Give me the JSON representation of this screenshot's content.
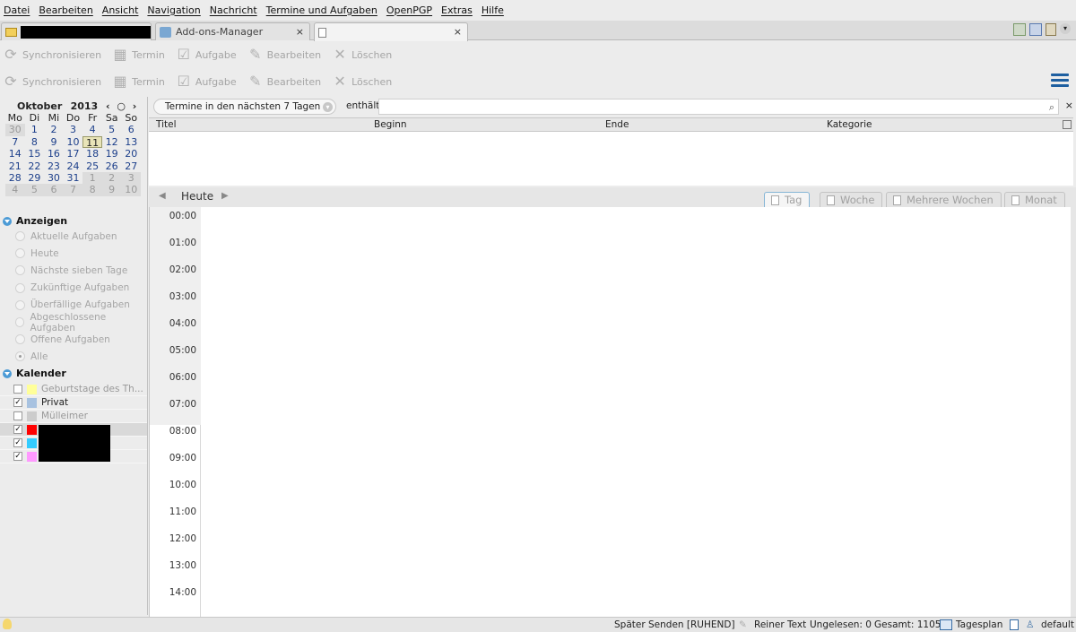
{
  "menu": [
    "Datei",
    "Bearbeiten",
    "Ansicht",
    "Navigation",
    "Nachricht",
    "Termine und Aufgaben",
    "OpenPGP",
    "Extras",
    "Hilfe"
  ],
  "tabs": {
    "addons": "Add-ons-Manager"
  },
  "toolbar": {
    "sync": "Synchronisieren",
    "event": "Termin",
    "task": "Aufgabe",
    "edit": "Bearbeiten",
    "delete": "Löschen"
  },
  "minimonth": {
    "month": "Oktober",
    "year": "2013",
    "dows": [
      "Mo",
      "Di",
      "Mi",
      "Do",
      "Fr",
      "Sa",
      "So"
    ],
    "weeks": [
      [
        "30",
        "1",
        "2",
        "3",
        "4",
        "5",
        "6"
      ],
      [
        "7",
        "8",
        "9",
        "10",
        "11",
        "12",
        "13"
      ],
      [
        "14",
        "15",
        "16",
        "17",
        "18",
        "19",
        "20"
      ],
      [
        "21",
        "22",
        "23",
        "24",
        "25",
        "26",
        "27"
      ],
      [
        "28",
        "29",
        "30",
        "31",
        "1",
        "2",
        "3"
      ],
      [
        "4",
        "5",
        "6",
        "7",
        "8",
        "9",
        "10"
      ]
    ],
    "today": "11"
  },
  "sidebar": {
    "show_label": "Anzeigen",
    "filters": [
      "Aktuelle Aufgaben",
      "Heute",
      "Nächste sieben Tage",
      "Zukünftige Aufgaben",
      "Überfällige Aufgaben",
      "Abgeschlossene Aufgaben",
      "Offene Aufgaben",
      "Alle"
    ],
    "calendars_label": "Kalender",
    "calendars": [
      {
        "name": "Geburtstage des Th...",
        "color": "#ffff99",
        "checked": false
      },
      {
        "name": "Privat",
        "color": "#a8c2e0",
        "checked": true
      },
      {
        "name": "Mülleimer",
        "color": "#cccccc",
        "checked": false
      },
      {
        "name": "",
        "color": "#ff0000",
        "checked": true
      },
      {
        "name": "",
        "color": "#33ccff",
        "checked": true
      },
      {
        "name": "",
        "color": "#ff99ff",
        "checked": true
      }
    ]
  },
  "search": {
    "filter": "Termine in den nächsten 7 Tagen",
    "contains": "enthält"
  },
  "list": {
    "cols": [
      "Titel",
      "Beginn",
      "Ende",
      "Kategorie"
    ]
  },
  "view": {
    "today": "Heute",
    "tabs": [
      "Tag",
      "Woche",
      "Mehrere Wochen",
      "Monat"
    ]
  },
  "hours": [
    "00:00",
    "01:00",
    "02:00",
    "03:00",
    "04:00",
    "05:00",
    "06:00",
    "07:00",
    "08:00",
    "09:00",
    "10:00",
    "11:00",
    "12:00",
    "13:00",
    "14:00"
  ],
  "status": {
    "send_later": "Später Senden [RUHEND]",
    "plain": "Reiner Text",
    "unread": "Ungelesen: 0",
    "total": "Gesamt: 1105",
    "dayplan": "Tagesplan",
    "profile": "default"
  }
}
